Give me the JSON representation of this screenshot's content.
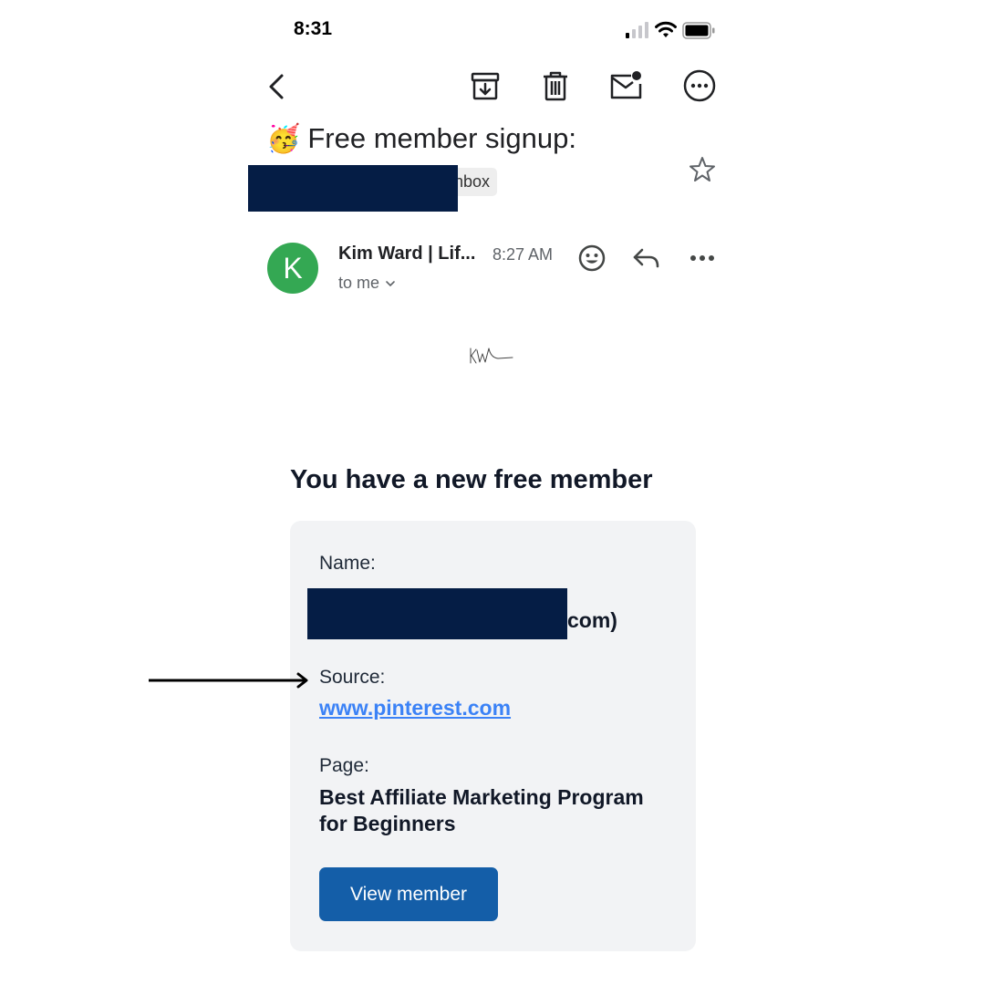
{
  "status_bar": {
    "time": "8:31",
    "icons": [
      "signal-icon",
      "wifi-icon",
      "battery-icon"
    ]
  },
  "toolbar": {
    "icons": [
      "back-arrow-icon",
      "archive-icon",
      "trash-icon",
      "mark-unread-icon",
      "more-options-icon"
    ]
  },
  "email": {
    "subject_emoji": "🥳",
    "subject": "Free member signup:",
    "label_visible_text": "nbox",
    "star_icon": "star-outline-icon",
    "sender": {
      "avatar_letter": "K",
      "avatar_color": "#34a853",
      "name": "Kim Ward | Lif...",
      "time": "8:27 AM",
      "to": "to me"
    }
  },
  "body": {
    "logo_text": "KW",
    "headline": "You have a new free member",
    "fields": {
      "name_label": "Name:",
      "name_visible_suffix": "com)",
      "source_label": "Source:",
      "source_link": "www.pinterest.com",
      "page_label": "Page:",
      "page_value": "Best Affiliate Marketing Program for Beginners"
    },
    "button_label": "View member"
  },
  "colors": {
    "redaction": "#051d45",
    "button": "#145ea8",
    "link": "#3b82f6",
    "card_bg": "#f2f3f5"
  }
}
